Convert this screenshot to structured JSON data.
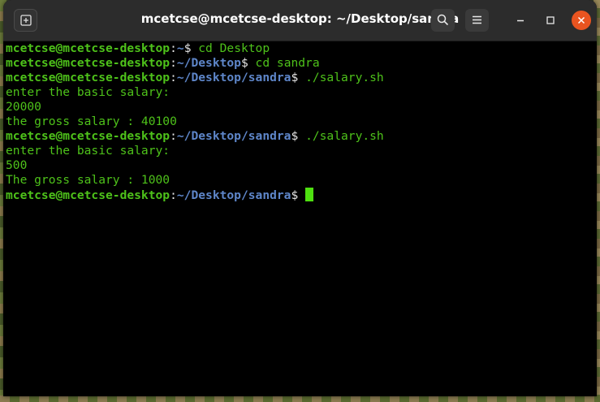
{
  "window": {
    "title": "mcetcse@mcetcse-desktop: ~/Desktop/sandra",
    "accent_close": "#e95420"
  },
  "icons": {
    "new_tab": "new-tab-icon",
    "search": "search-icon",
    "menu": "hamburger-menu-icon",
    "minimize": "minimize-icon",
    "maximize": "maximize-icon",
    "close": "close-icon"
  },
  "colors": {
    "prompt_user": "#4ec21a",
    "prompt_path": "#5e86c9",
    "cursor": "#4ee010",
    "background": "#000000"
  },
  "terminal": {
    "lines": [
      {
        "type": "prompt",
        "user": "mcetcse@mcetcse-desktop",
        "path": "~",
        "command": " cd Desktop"
      },
      {
        "type": "prompt",
        "user": "mcetcse@mcetcse-desktop",
        "path": "~/Desktop",
        "command": " cd sandra"
      },
      {
        "type": "prompt",
        "user": "mcetcse@mcetcse-desktop",
        "path": "~/Desktop/sandra",
        "command": " ./salary.sh"
      },
      {
        "type": "output",
        "text": "enter the basic salary:"
      },
      {
        "type": "output",
        "text": "20000"
      },
      {
        "type": "output",
        "text": "the gross salary : 40100"
      },
      {
        "type": "prompt",
        "user": "mcetcse@mcetcse-desktop",
        "path": "~/Desktop/sandra",
        "command": " ./salary.sh"
      },
      {
        "type": "output",
        "text": "enter the basic salary:"
      },
      {
        "type": "output",
        "text": "500"
      },
      {
        "type": "output",
        "text": "The gross salary : 1000"
      },
      {
        "type": "prompt",
        "user": "mcetcse@mcetcse-desktop",
        "path": "~/Desktop/sandra",
        "command": ""
      }
    ]
  }
}
